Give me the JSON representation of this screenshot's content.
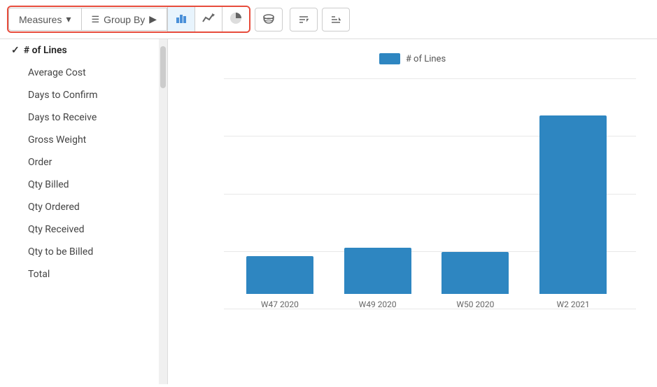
{
  "toolbar": {
    "measures_label": "Measures",
    "groupby_label": "Group By",
    "chart_bar_icon": "▐▌",
    "chart_line_icon": "📈",
    "chart_pie_icon": "◑",
    "stack_icon": "⊞",
    "sort_asc_icon": "↑≡",
    "sort_desc_icon": "↓≡"
  },
  "sidebar": {
    "items": [
      {
        "label": "# of Lines",
        "active": true,
        "checked": true
      },
      {
        "label": "Average Cost",
        "active": false,
        "checked": false
      },
      {
        "label": "Days to Confirm",
        "active": false,
        "checked": false
      },
      {
        "label": "Days to Receive",
        "active": false,
        "checked": false
      },
      {
        "label": "Gross Weight",
        "active": false,
        "checked": false
      },
      {
        "label": "Order",
        "active": false,
        "checked": false
      },
      {
        "label": "Qty Billed",
        "active": false,
        "checked": false
      },
      {
        "label": "Qty Ordered",
        "active": false,
        "checked": false
      },
      {
        "label": "Qty Received",
        "active": false,
        "checked": false
      },
      {
        "label": "Qty to be Billed",
        "active": false,
        "checked": false
      },
      {
        "label": "Total",
        "active": false,
        "checked": false
      }
    ]
  },
  "chart": {
    "legend_label": "# of Lines",
    "bars": [
      {
        "label": "W47 2020",
        "height_pct": 18
      },
      {
        "label": "W49 2020",
        "height_pct": 22
      },
      {
        "label": "W50 2020",
        "height_pct": 20
      },
      {
        "label": "W2 2021",
        "height_pct": 85
      }
    ],
    "bar_color": "#2e86c1"
  }
}
